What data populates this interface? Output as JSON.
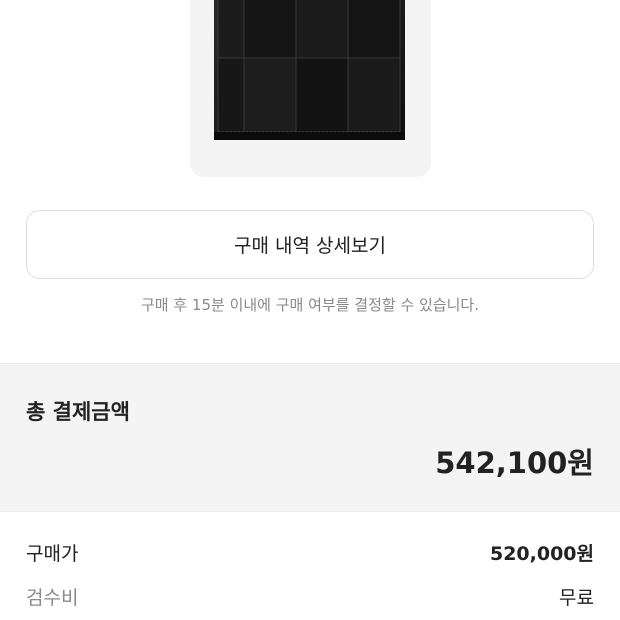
{
  "colors": {
    "background": "#ffffff",
    "card_background": "#f4f4f4",
    "primary_text": "#222222",
    "secondary_text": "#8a8a8a",
    "border": "#dedede"
  },
  "product": {
    "image_icon": "black-leather-woven-wallet-image"
  },
  "detail_button": {
    "label": "구매 내역 상세보기"
  },
  "notice": "구매 후 15분 이내에 구매 여부를 결정할 수 있습니다.",
  "total": {
    "title": "총 결제금액",
    "amount": "542,100원"
  },
  "breakdown": [
    {
      "label": "구매가",
      "value": "520,000원"
    },
    {
      "label": "검수비",
      "value": "무료"
    }
  ]
}
